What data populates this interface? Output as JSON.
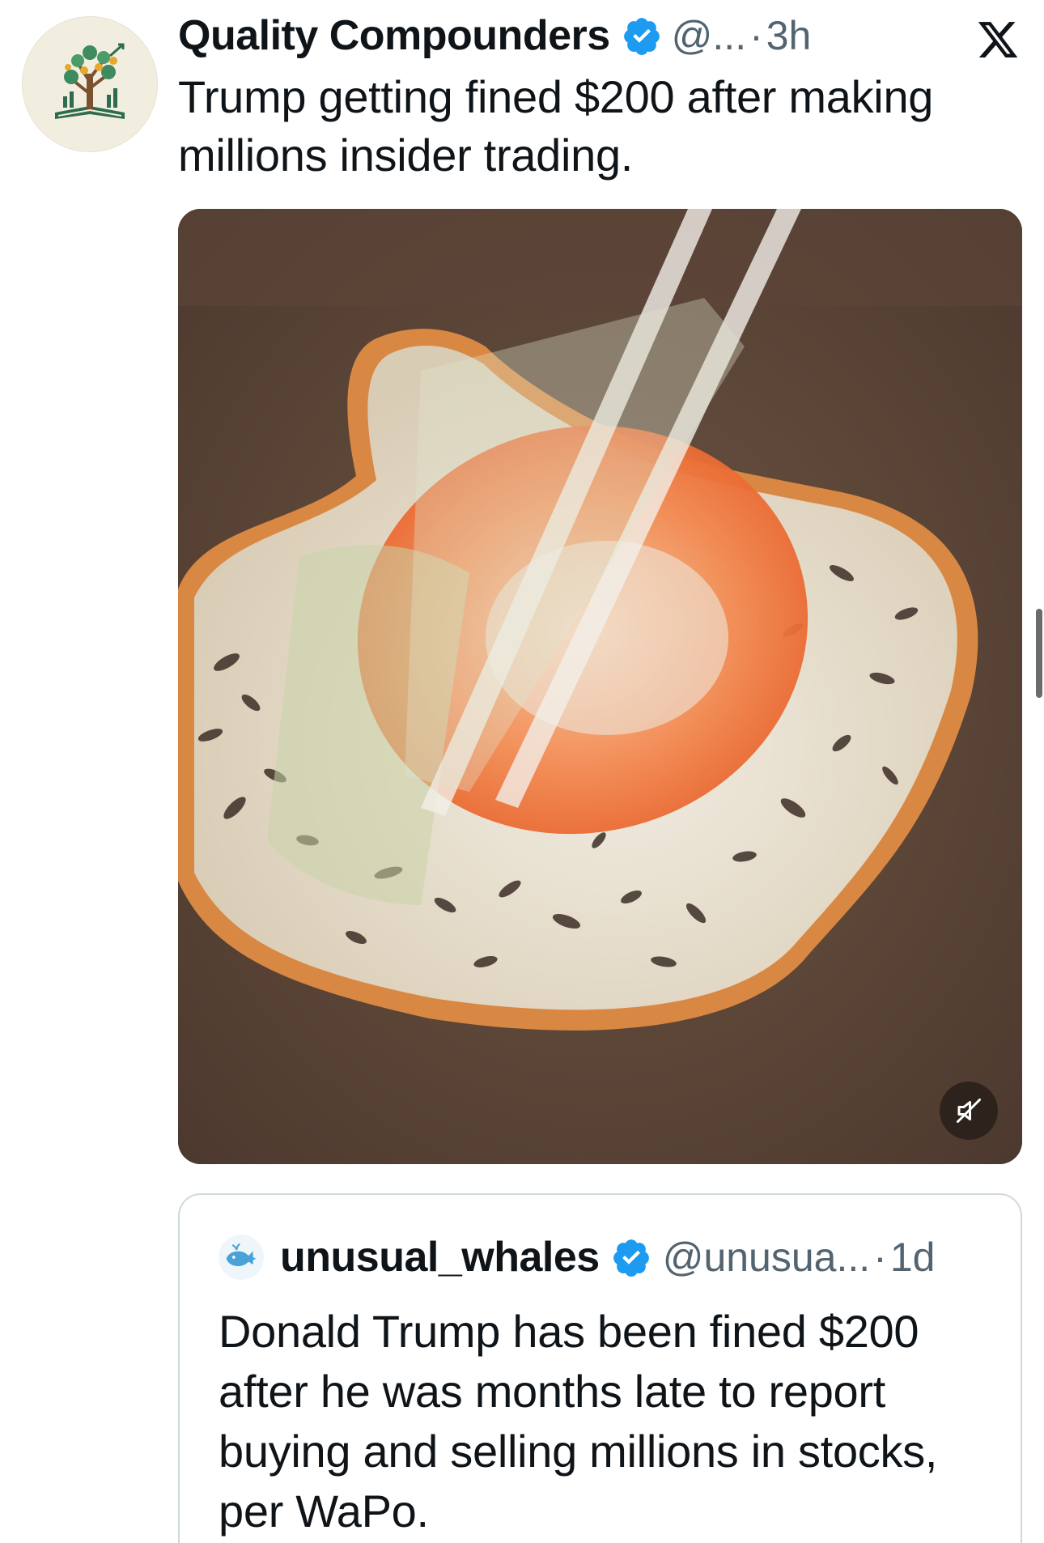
{
  "post": {
    "display_name": "Quality Compounders",
    "handle": "@...",
    "separator": "·",
    "time": "3h",
    "text": "Trump getting fined $200 after making millions insider trading."
  },
  "media": {
    "type": "video",
    "muted": true
  },
  "quoted_post": {
    "display_name": "unusual_whales",
    "handle": "@unusua...",
    "separator": "·",
    "time": "1d",
    "text": "Donald Trump has been fined $200 after he was months late to report buying and selling millions in stocks, per WaPo."
  },
  "colors": {
    "verified": "#1d9bf0",
    "secondary_text": "#536471",
    "border": "#cfd9de"
  },
  "icons": {
    "verified": "verified-badge-icon",
    "app": "x-logo-icon",
    "mute": "speaker-muted-icon"
  }
}
